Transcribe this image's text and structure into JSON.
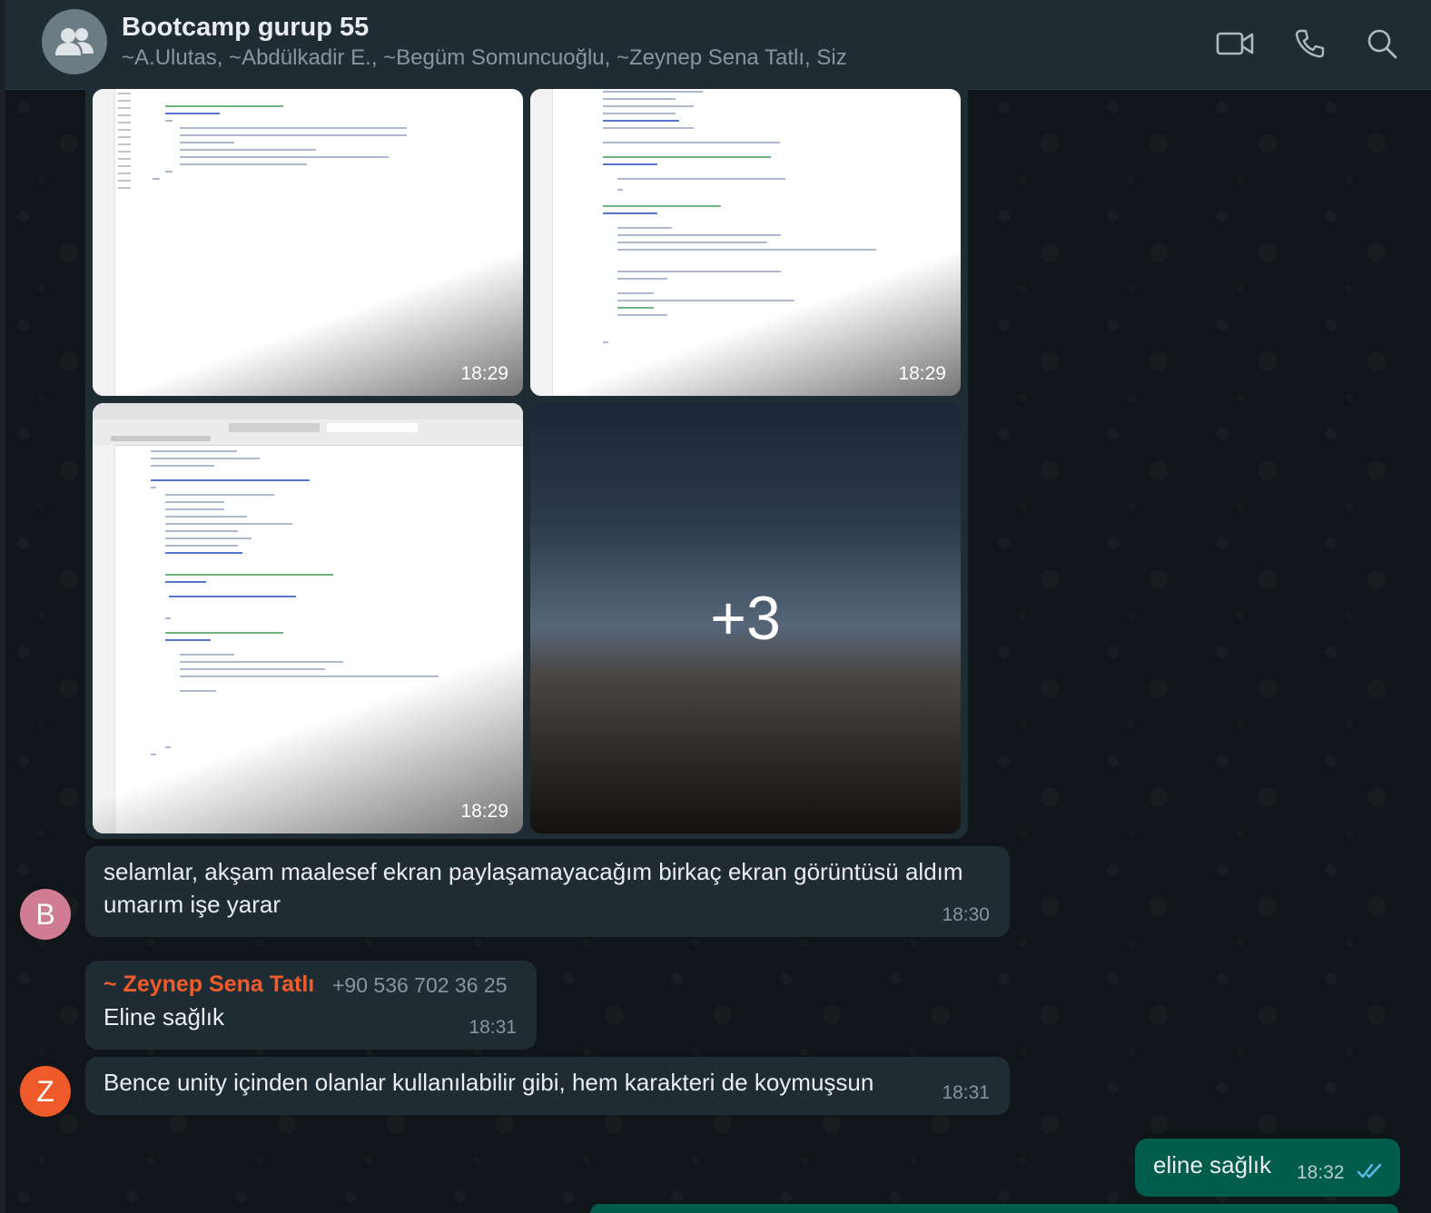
{
  "header": {
    "title": "Bootcamp gurup 55",
    "participants": "~A.Ulutas, ~Abdülkadir E., ~Begüm Somuncuoğlu, ~Zeynep Sena Tatlı, Siz",
    "icons": [
      "group-avatar-icon",
      "video-call-icon",
      "voice-call-icon",
      "search-icon"
    ]
  },
  "media": {
    "thumbs": [
      {
        "time": "18:29"
      },
      {
        "time": "18:29"
      },
      {
        "time": "18:29"
      }
    ],
    "more_label": "+3"
  },
  "messages": [
    {
      "sender_initial": "B",
      "avatar_color": "#d07c93",
      "text": "selamlar, akşam maalesef ekran paylaşamayacağım birkaç ekran görüntüsü aldım umarım işe yarar",
      "time": "18:30"
    },
    {
      "sender_name": "~ Zeynep Sena Tatlı",
      "sender_phone": "+90 536 702 36 25",
      "text": "Eline sağlık",
      "time": "18:31"
    },
    {
      "sender_initial": "Z",
      "avatar_color": "#ef5a2a",
      "text": "Bence unity içinden olanlar kullanılabilir gibi, hem karakteri de koymuşsun",
      "time": "18:31"
    }
  ],
  "outgoing": {
    "text": "eline sağlık",
    "time": "18:32",
    "status_icon": "double-check-icon"
  },
  "colors": {
    "header_bg": "#202c33",
    "incoming_bubble": "#202c33",
    "outgoing_bubble": "#005c4b",
    "sender_name": "#f15c2b",
    "read_tick": "#53bdeb"
  }
}
